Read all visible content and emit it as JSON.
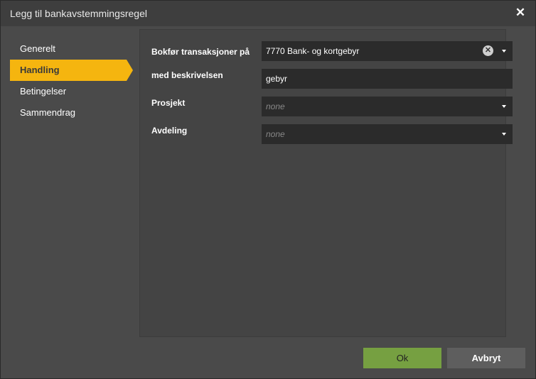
{
  "dialog": {
    "title": "Legg til bankavstemmingsregel",
    "close_glyph": "✕"
  },
  "sidebar": {
    "items": [
      {
        "label": "Generelt",
        "active": false
      },
      {
        "label": "Handling",
        "active": true
      },
      {
        "label": "Betingelser",
        "active": false
      },
      {
        "label": "Sammendrag",
        "active": false
      }
    ]
  },
  "form": {
    "account": {
      "label": "Bokfør transaksjoner på",
      "value": "7770 Bank- og kortgebyr",
      "clear_glyph": "✕"
    },
    "description": {
      "label": "med beskrivelsen",
      "value": "gebyr"
    },
    "project": {
      "label": "Prosjekt",
      "placeholder": "none"
    },
    "department": {
      "label": "Avdeling",
      "placeholder": "none"
    }
  },
  "buttons": {
    "ok": "Ok",
    "cancel": "Avbryt"
  },
  "colors": {
    "accent": "#f5b50f",
    "ok": "#76a041"
  }
}
